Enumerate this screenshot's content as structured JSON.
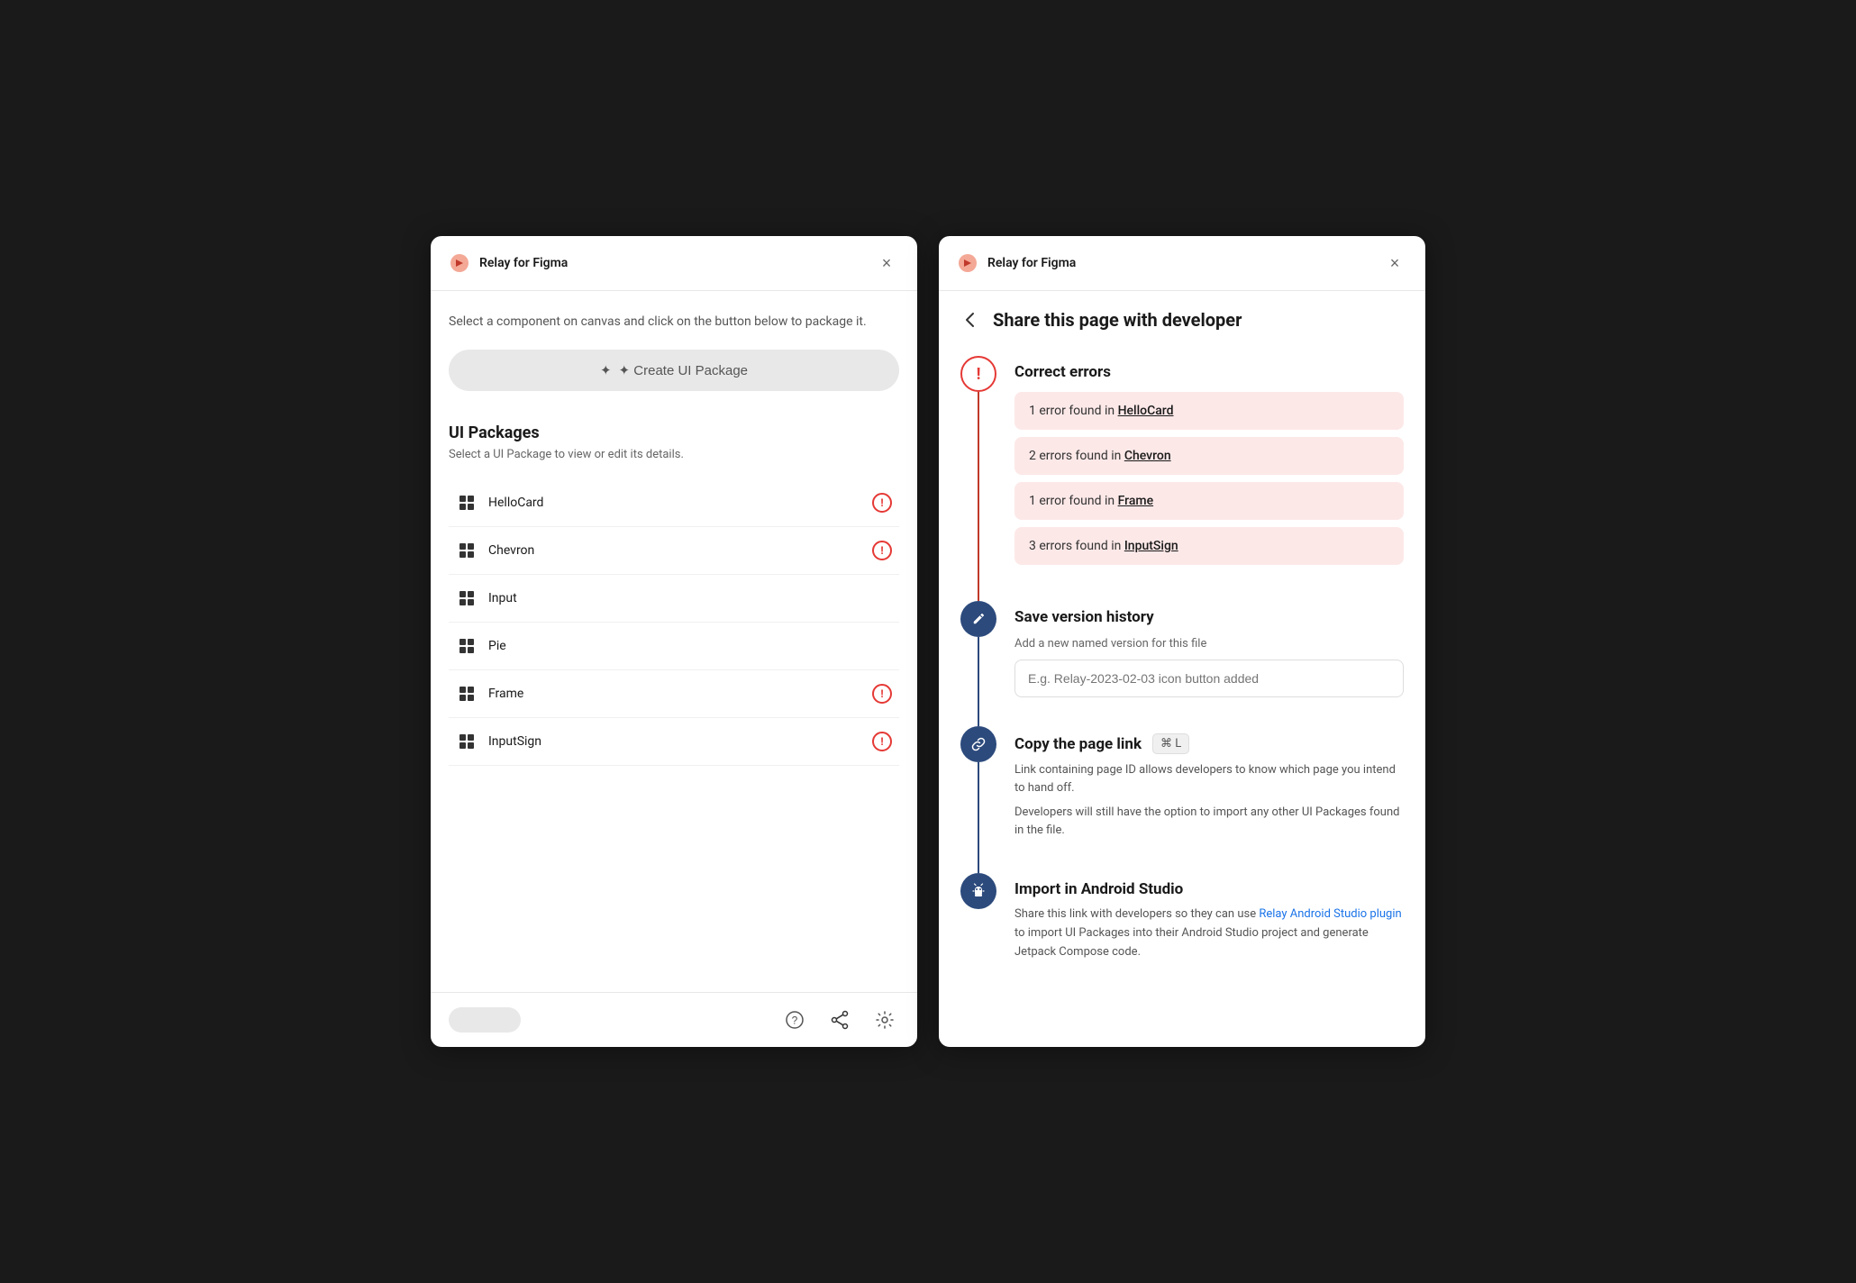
{
  "left": {
    "title": "Relay for Figma",
    "close_label": "×",
    "instruction": "Select a component on canvas and click on the button below to package it.",
    "create_btn": "✦  Create UI Package",
    "packages_title": "UI Packages",
    "packages_subtitle": "Select a UI Package to view or edit its details.",
    "packages": [
      {
        "name": "HelloCard",
        "has_error": true
      },
      {
        "name": "Chevron",
        "has_error": true
      },
      {
        "name": "Input",
        "has_error": false
      },
      {
        "name": "Pie",
        "has_error": false
      },
      {
        "name": "Frame",
        "has_error": true
      },
      {
        "name": "InputSign",
        "has_error": true
      }
    ],
    "footer_icons": {
      "help": "?",
      "share": "share",
      "settings": "⚙"
    }
  },
  "right": {
    "title": "Relay for Figma",
    "close_label": "×",
    "back_label": "←",
    "page_title": "Share this page with developer",
    "sections": {
      "correct_errors": {
        "title": "Correct errors",
        "errors": [
          {
            "text": "1 error found in ",
            "link": "HelloCard"
          },
          {
            "text": "2 errors found in ",
            "link": "Chevron"
          },
          {
            "text": "1 error found in ",
            "link": "Frame"
          },
          {
            "text": "3 errors found in ",
            "link": "InputSign"
          }
        ]
      },
      "version": {
        "title": "Save version history",
        "subtitle": "Add a new named version for this file",
        "placeholder": "E.g. Relay-2023-02-03 icon button added"
      },
      "copy_link": {
        "title": "Copy the page link",
        "shortcut": "⌘ L",
        "desc1": "Link containing page ID allows developers to know which page you intend to hand off.",
        "desc2": "Developers will still have the option to import any other UI Packages found in the file."
      },
      "android": {
        "title": "Import in Android Studio",
        "desc_before": "Share this link with developers so they can use ",
        "link_text": "Relay Android Studio plugin",
        "desc_after": " to import UI Packages into their Android Studio project and generate Jetpack Compose code."
      }
    }
  }
}
